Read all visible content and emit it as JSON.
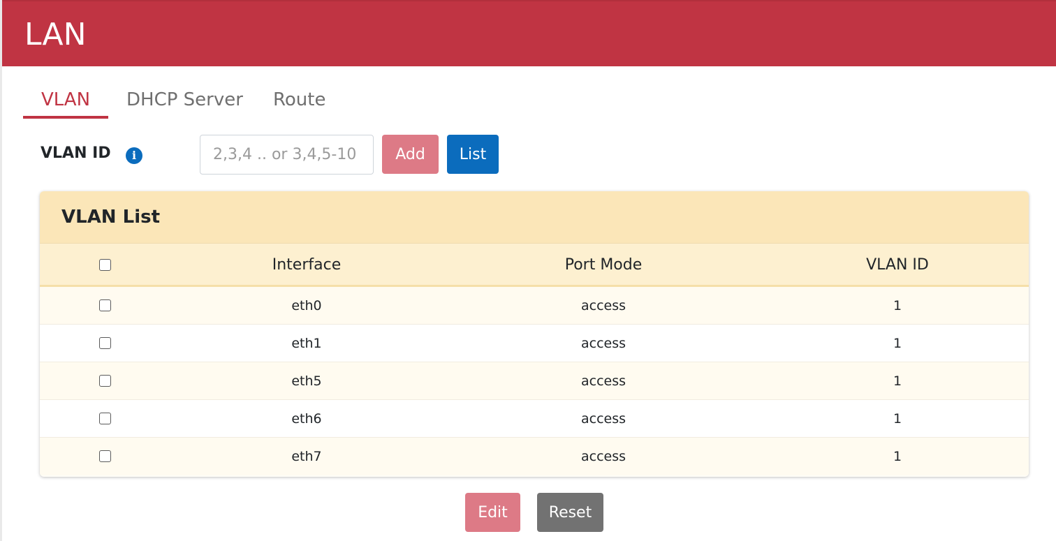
{
  "header": {
    "title": "LAN"
  },
  "tabs": [
    {
      "label": "VLAN",
      "active": true
    },
    {
      "label": "DHCP Server",
      "active": false
    },
    {
      "label": "Route",
      "active": false
    }
  ],
  "form": {
    "vlan_id_label": "VLAN ID",
    "info_icon": "info-icon",
    "input_value": "",
    "input_placeholder": "2,3,4 .. or 3,4,5-10 ..",
    "add_label": "Add",
    "list_label": "List"
  },
  "vlan_list": {
    "title": "VLAN List",
    "columns": [
      "Interface",
      "Port Mode",
      "VLAN ID"
    ],
    "rows": [
      {
        "interface": "eth0",
        "port_mode": "access",
        "vlan_id": "1"
      },
      {
        "interface": "eth1",
        "port_mode": "access",
        "vlan_id": "1"
      },
      {
        "interface": "eth5",
        "port_mode": "access",
        "vlan_id": "1"
      },
      {
        "interface": "eth6",
        "port_mode": "access",
        "vlan_id": "1"
      },
      {
        "interface": "eth7",
        "port_mode": "access",
        "vlan_id": "1"
      }
    ]
  },
  "actions": {
    "edit_label": "Edit",
    "reset_label": "Reset"
  },
  "colors": {
    "brand": "#c03443",
    "primary": "#0b6cbd",
    "disabled_danger": "#dd7a86",
    "secondary": "#727272",
    "card_header": "#fbe6b8"
  }
}
